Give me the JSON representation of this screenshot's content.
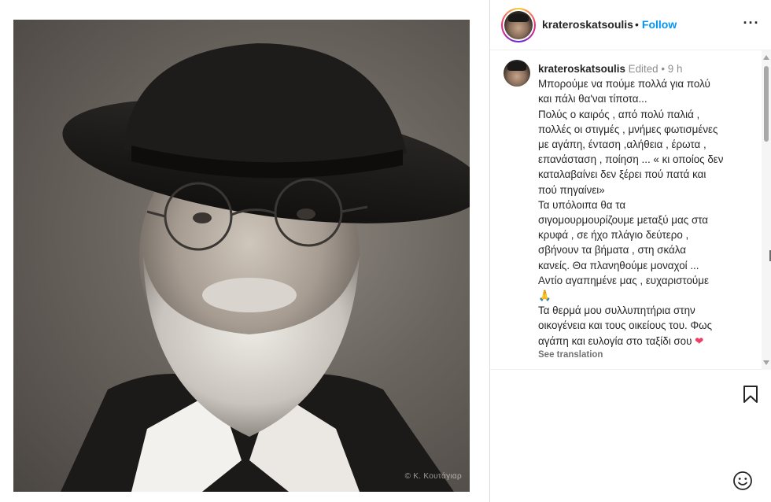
{
  "post": {
    "username": "krateroskatsoulis",
    "follow_label": "Follow",
    "more_label": "···",
    "photo_credit": "© Κ. Κουτάγιαρ"
  },
  "caption": {
    "username": "krateroskatsoulis",
    "edited_label": "Edited",
    "time": "9 h",
    "lines": [
      "Μπορούμε να πούμε πολλά για πολύ",
      "και πάλι θα'ναι τίποτα...",
      "Πολύς ο καιρός , από πολύ παλιά ,",
      "πολλές οι στιγμές , μνήμες φωτισμένες",
      "με αγάπη, ένταση ,αλήθεια , έρωτα ,",
      "επανάσταση , ποίηση ... « κι οποίος δεν",
      "καταλαβαίνει δεν ξέρει πού πατά και",
      "πού πηγαίνει»",
      "Τα υπόλοιπα θα τα",
      "σιγομουρμουρίζουμε μεταξύ μας στα",
      "κρυφά , σε ήχο πλάγιο δεύτερο ,",
      "σβήνουν τα βήματα , στη σκάλα",
      "κανείς. Θα πλανηθούμε μοναχοί ...",
      "Αντίο αγαπημένε μας , ευχαριστούμε",
      "🙏",
      "Τα θερμά μου συλλυπητήρια στην",
      "οικογένεια και τους οικείους του. Φως",
      "αγάπη και ευλογία στο ταξίδι σου ❤"
    ],
    "see_translation": "See translation"
  },
  "icons": {
    "more": "more-options-icon",
    "bookmark": "bookmark-icon",
    "emoji": "emoji-icon",
    "pray": "folded-hands-emoji",
    "heart": "heart-emoji"
  },
  "colors": {
    "follow": "#0095f6",
    "meta_text": "#8e8e8e",
    "text": "#262626",
    "heart": "#ed3e63"
  }
}
